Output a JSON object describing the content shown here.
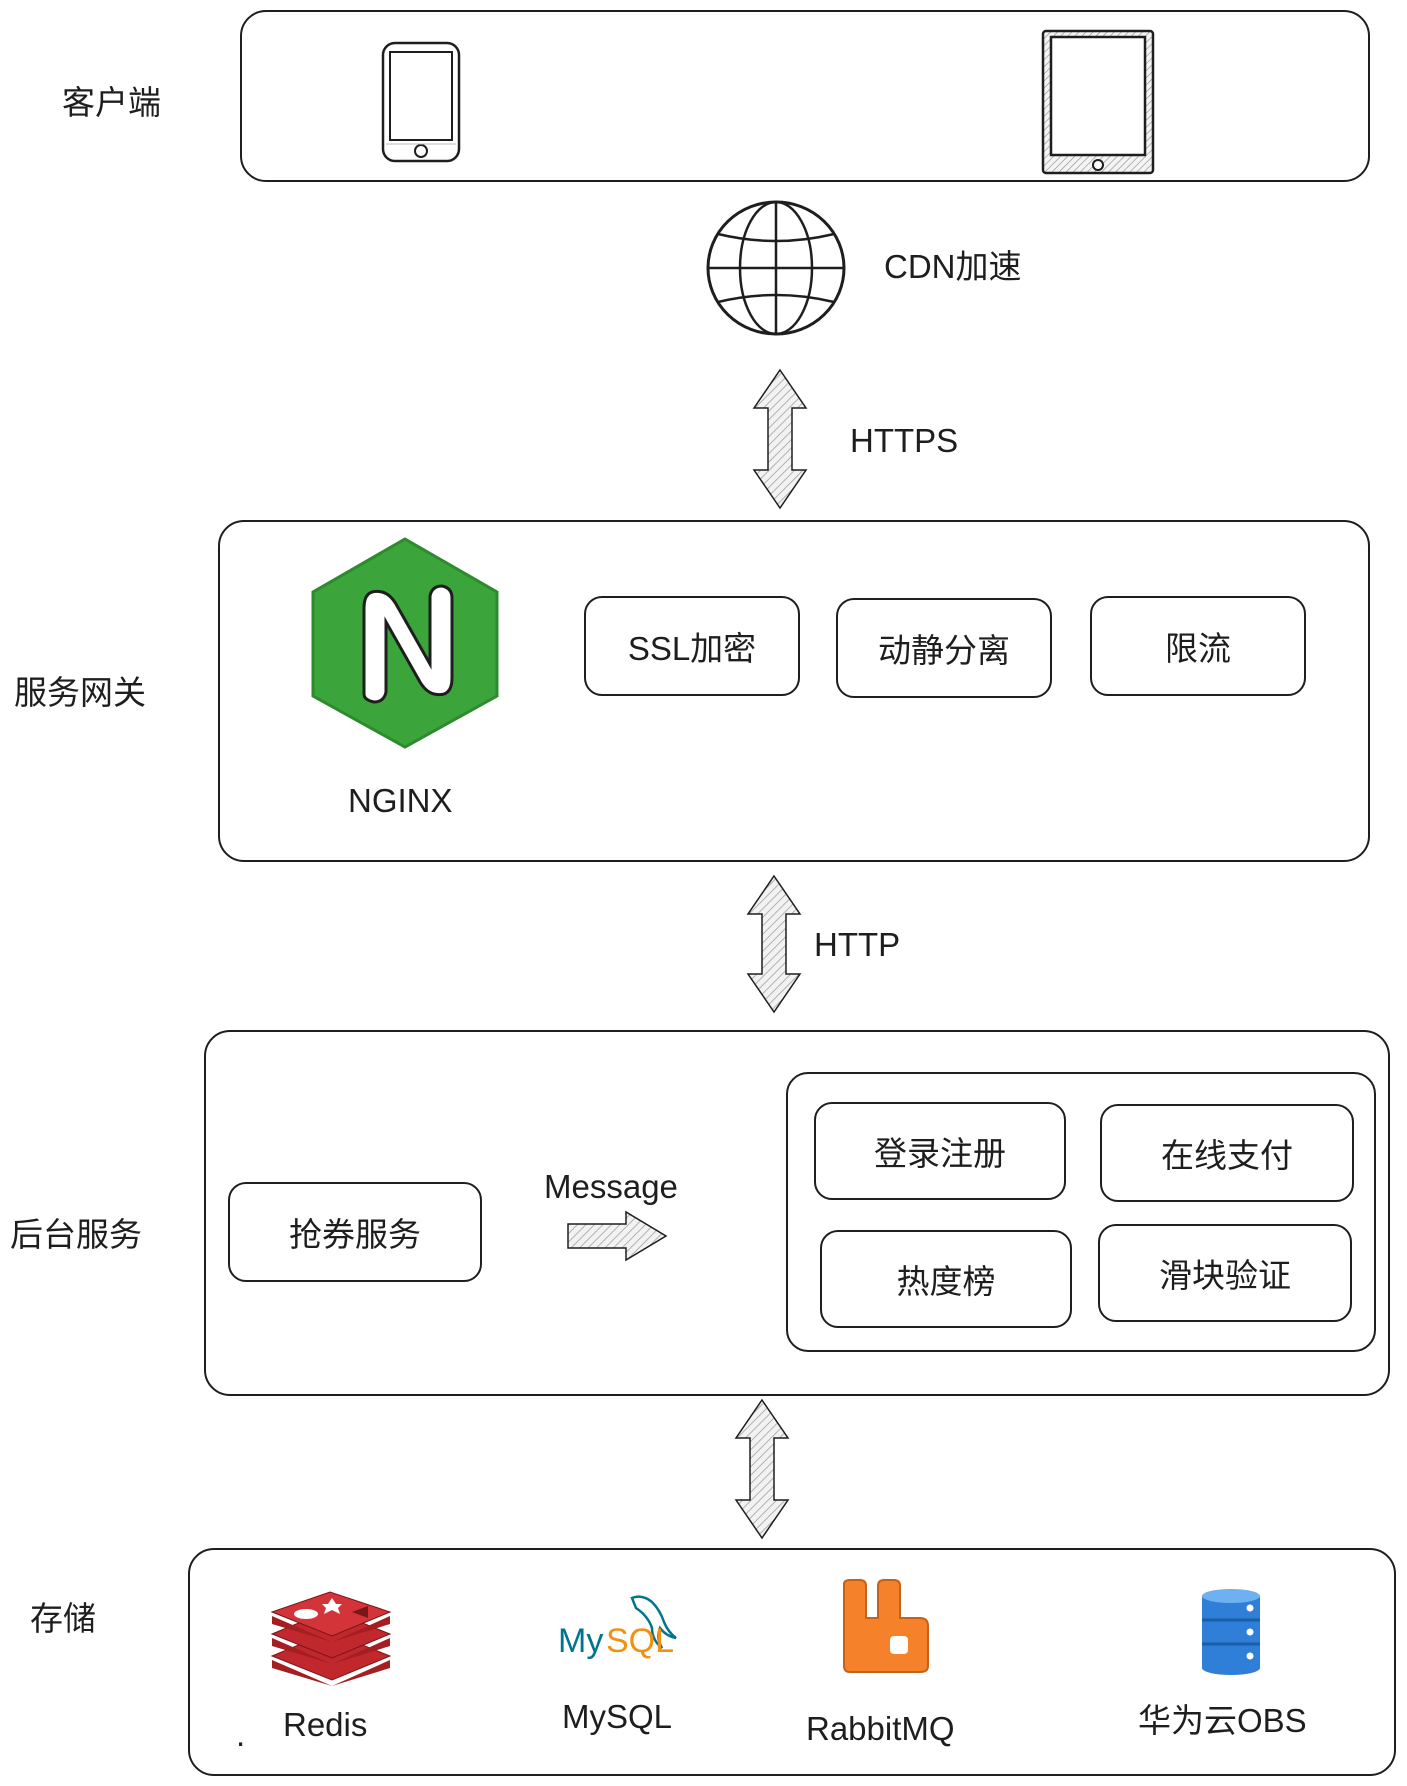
{
  "layers": {
    "client": "客户端",
    "gateway": "服务网关",
    "backend": "后台服务",
    "storage": "存储"
  },
  "cdn_label": "CDN加速",
  "protocols": {
    "https": "HTTPS",
    "http": "HTTP"
  },
  "gateway": {
    "nginx_label": "NGINX",
    "features": [
      "SSL加密",
      "动静分离",
      "限流"
    ]
  },
  "backend": {
    "coupon_service": "抢券服务",
    "message_label": "Message",
    "services": [
      "登录注册",
      "在线支付",
      "热度榜",
      "滑块验证"
    ]
  },
  "storage": {
    "dot": ".",
    "items": [
      "Redis",
      "MySQL",
      "RabbitMQ",
      "华为云OBS"
    ],
    "mysql_logo_text": {
      "my": "My",
      "sql": "SQL"
    }
  },
  "colors": {
    "nginx_green": "#3ba53b",
    "redis_red": "#c0282d",
    "rabbit_orange": "#f5822a",
    "obs_blue": "#2f7fd8",
    "mysql_blue": "#00758f",
    "mysql_orange": "#f29111"
  },
  "icons": [
    "phone-icon",
    "tablet-icon",
    "globe-icon",
    "nginx-logo",
    "redis-logo",
    "mysql-logo",
    "rabbitmq-logo",
    "database-icon"
  ]
}
